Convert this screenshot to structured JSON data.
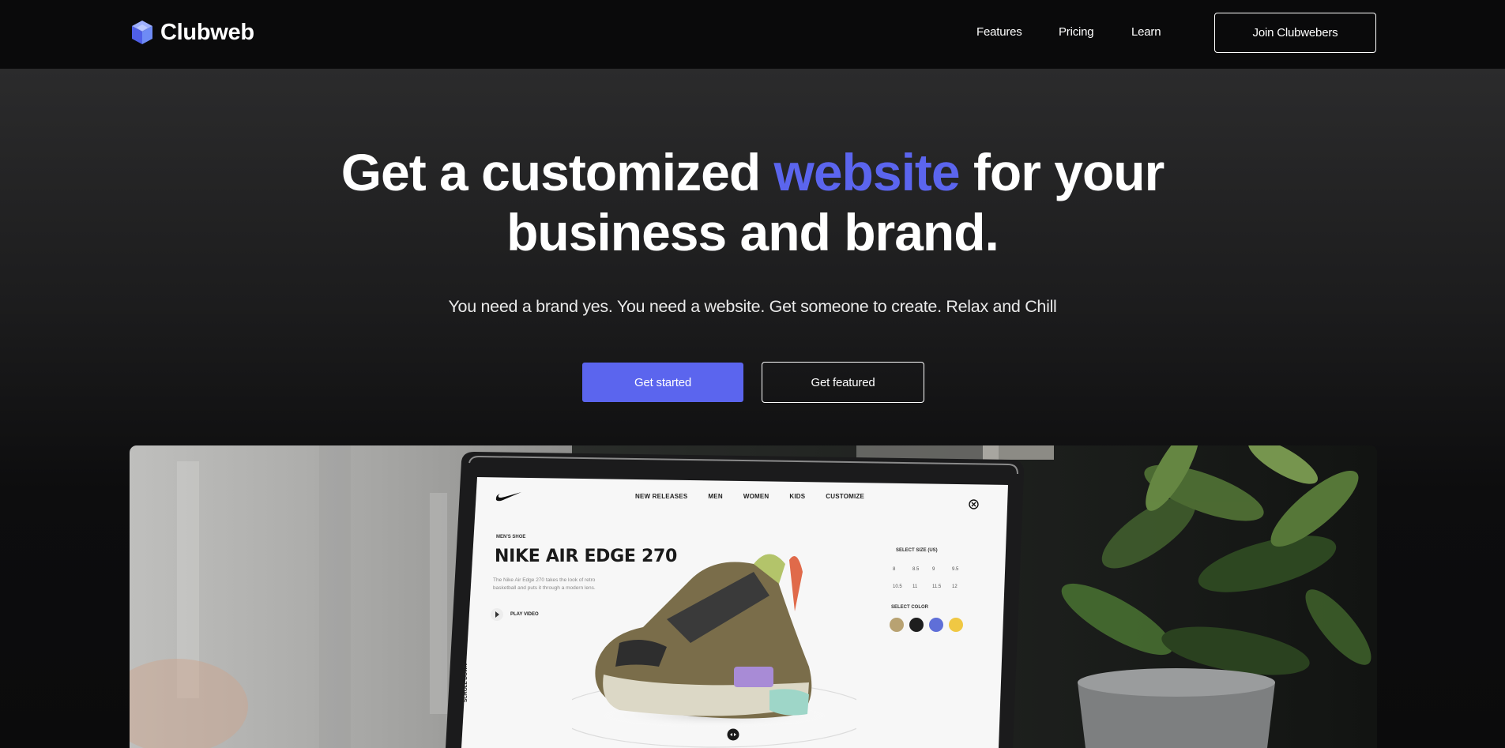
{
  "brand": {
    "name": "Clubweb",
    "logo_icon": "cube-logo-icon",
    "accent_color": "#5b65ee"
  },
  "nav": {
    "links": [
      "Features",
      "Pricing",
      "Learn"
    ],
    "cta_label": "Join Clubwebers"
  },
  "hero": {
    "headline_part1": "Get a customized ",
    "headline_accent": "website",
    "headline_part2": " for your",
    "headline_line2": "business and brand.",
    "subtitle": "You need a brand yes. You need a website. Get someone to create. Relax and Chill",
    "primary_label": "Get started",
    "secondary_label": "Get featured"
  },
  "showcase": {
    "nav": [
      "NEW RELEASES",
      "MEN",
      "WOMEN",
      "KIDS",
      "CUSTOMIZE"
    ],
    "category": "MEN'S SHOE",
    "product_name": "NIKE AIR EDGE 270",
    "description_line1": "The Nike Air Edge 270 takes the look of retro",
    "description_line2": "basketball and puts it through a modern lens.",
    "play_label": "PLAY VIDEO",
    "size_title": "SELECT SIZE (US)",
    "sizes": [
      "8",
      "8.5",
      "9",
      "9.5",
      "10.5",
      "11",
      "11.5",
      "12"
    ],
    "color_title": "SELECT COLOR",
    "colors": [
      "#b8a272",
      "#1e1e1e",
      "#5f6fd8",
      "#f0c843"
    ],
    "scroll_label": "SCROLL DOWN"
  }
}
